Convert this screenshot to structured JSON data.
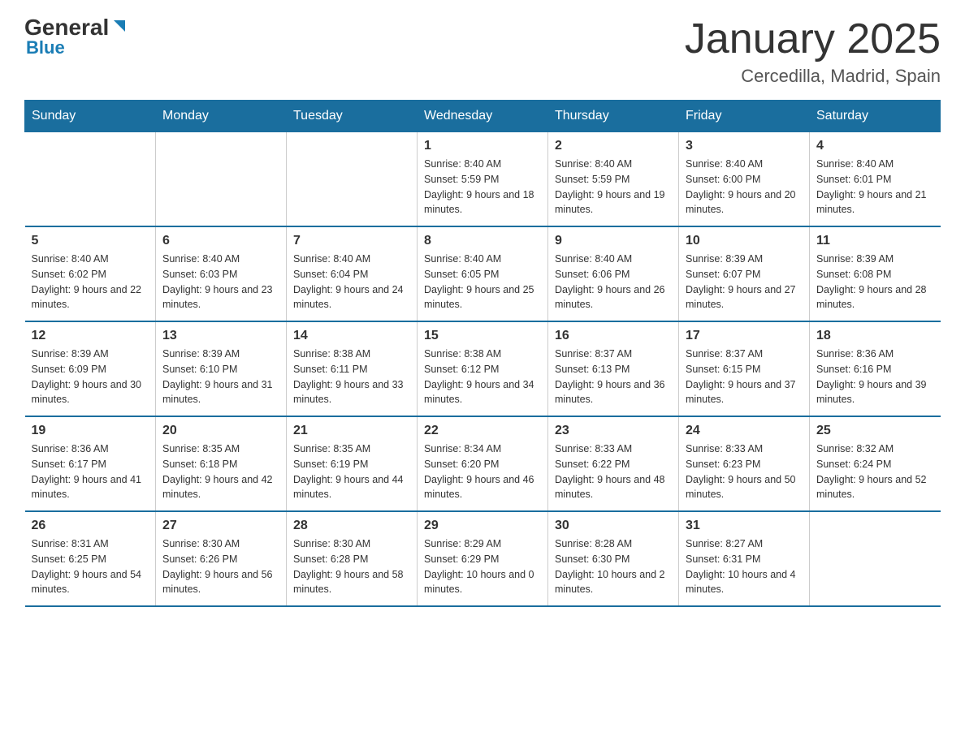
{
  "header": {
    "logo_general": "General",
    "logo_blue": "Blue",
    "month": "January 2025",
    "location": "Cercedilla, Madrid, Spain"
  },
  "days_of_week": [
    "Sunday",
    "Monday",
    "Tuesday",
    "Wednesday",
    "Thursday",
    "Friday",
    "Saturday"
  ],
  "weeks": [
    [
      {
        "day": "",
        "sunrise": "",
        "sunset": "",
        "daylight": ""
      },
      {
        "day": "",
        "sunrise": "",
        "sunset": "",
        "daylight": ""
      },
      {
        "day": "",
        "sunrise": "",
        "sunset": "",
        "daylight": ""
      },
      {
        "day": "1",
        "sunrise": "Sunrise: 8:40 AM",
        "sunset": "Sunset: 5:59 PM",
        "daylight": "Daylight: 9 hours and 18 minutes."
      },
      {
        "day": "2",
        "sunrise": "Sunrise: 8:40 AM",
        "sunset": "Sunset: 5:59 PM",
        "daylight": "Daylight: 9 hours and 19 minutes."
      },
      {
        "day": "3",
        "sunrise": "Sunrise: 8:40 AM",
        "sunset": "Sunset: 6:00 PM",
        "daylight": "Daylight: 9 hours and 20 minutes."
      },
      {
        "day": "4",
        "sunrise": "Sunrise: 8:40 AM",
        "sunset": "Sunset: 6:01 PM",
        "daylight": "Daylight: 9 hours and 21 minutes."
      }
    ],
    [
      {
        "day": "5",
        "sunrise": "Sunrise: 8:40 AM",
        "sunset": "Sunset: 6:02 PM",
        "daylight": "Daylight: 9 hours and 22 minutes."
      },
      {
        "day": "6",
        "sunrise": "Sunrise: 8:40 AM",
        "sunset": "Sunset: 6:03 PM",
        "daylight": "Daylight: 9 hours and 23 minutes."
      },
      {
        "day": "7",
        "sunrise": "Sunrise: 8:40 AM",
        "sunset": "Sunset: 6:04 PM",
        "daylight": "Daylight: 9 hours and 24 minutes."
      },
      {
        "day": "8",
        "sunrise": "Sunrise: 8:40 AM",
        "sunset": "Sunset: 6:05 PM",
        "daylight": "Daylight: 9 hours and 25 minutes."
      },
      {
        "day": "9",
        "sunrise": "Sunrise: 8:40 AM",
        "sunset": "Sunset: 6:06 PM",
        "daylight": "Daylight: 9 hours and 26 minutes."
      },
      {
        "day": "10",
        "sunrise": "Sunrise: 8:39 AM",
        "sunset": "Sunset: 6:07 PM",
        "daylight": "Daylight: 9 hours and 27 minutes."
      },
      {
        "day": "11",
        "sunrise": "Sunrise: 8:39 AM",
        "sunset": "Sunset: 6:08 PM",
        "daylight": "Daylight: 9 hours and 28 minutes."
      }
    ],
    [
      {
        "day": "12",
        "sunrise": "Sunrise: 8:39 AM",
        "sunset": "Sunset: 6:09 PM",
        "daylight": "Daylight: 9 hours and 30 minutes."
      },
      {
        "day": "13",
        "sunrise": "Sunrise: 8:39 AM",
        "sunset": "Sunset: 6:10 PM",
        "daylight": "Daylight: 9 hours and 31 minutes."
      },
      {
        "day": "14",
        "sunrise": "Sunrise: 8:38 AM",
        "sunset": "Sunset: 6:11 PM",
        "daylight": "Daylight: 9 hours and 33 minutes."
      },
      {
        "day": "15",
        "sunrise": "Sunrise: 8:38 AM",
        "sunset": "Sunset: 6:12 PM",
        "daylight": "Daylight: 9 hours and 34 minutes."
      },
      {
        "day": "16",
        "sunrise": "Sunrise: 8:37 AM",
        "sunset": "Sunset: 6:13 PM",
        "daylight": "Daylight: 9 hours and 36 minutes."
      },
      {
        "day": "17",
        "sunrise": "Sunrise: 8:37 AM",
        "sunset": "Sunset: 6:15 PM",
        "daylight": "Daylight: 9 hours and 37 minutes."
      },
      {
        "day": "18",
        "sunrise": "Sunrise: 8:36 AM",
        "sunset": "Sunset: 6:16 PM",
        "daylight": "Daylight: 9 hours and 39 minutes."
      }
    ],
    [
      {
        "day": "19",
        "sunrise": "Sunrise: 8:36 AM",
        "sunset": "Sunset: 6:17 PM",
        "daylight": "Daylight: 9 hours and 41 minutes."
      },
      {
        "day": "20",
        "sunrise": "Sunrise: 8:35 AM",
        "sunset": "Sunset: 6:18 PM",
        "daylight": "Daylight: 9 hours and 42 minutes."
      },
      {
        "day": "21",
        "sunrise": "Sunrise: 8:35 AM",
        "sunset": "Sunset: 6:19 PM",
        "daylight": "Daylight: 9 hours and 44 minutes."
      },
      {
        "day": "22",
        "sunrise": "Sunrise: 8:34 AM",
        "sunset": "Sunset: 6:20 PM",
        "daylight": "Daylight: 9 hours and 46 minutes."
      },
      {
        "day": "23",
        "sunrise": "Sunrise: 8:33 AM",
        "sunset": "Sunset: 6:22 PM",
        "daylight": "Daylight: 9 hours and 48 minutes."
      },
      {
        "day": "24",
        "sunrise": "Sunrise: 8:33 AM",
        "sunset": "Sunset: 6:23 PM",
        "daylight": "Daylight: 9 hours and 50 minutes."
      },
      {
        "day": "25",
        "sunrise": "Sunrise: 8:32 AM",
        "sunset": "Sunset: 6:24 PM",
        "daylight": "Daylight: 9 hours and 52 minutes."
      }
    ],
    [
      {
        "day": "26",
        "sunrise": "Sunrise: 8:31 AM",
        "sunset": "Sunset: 6:25 PM",
        "daylight": "Daylight: 9 hours and 54 minutes."
      },
      {
        "day": "27",
        "sunrise": "Sunrise: 8:30 AM",
        "sunset": "Sunset: 6:26 PM",
        "daylight": "Daylight: 9 hours and 56 minutes."
      },
      {
        "day": "28",
        "sunrise": "Sunrise: 8:30 AM",
        "sunset": "Sunset: 6:28 PM",
        "daylight": "Daylight: 9 hours and 58 minutes."
      },
      {
        "day": "29",
        "sunrise": "Sunrise: 8:29 AM",
        "sunset": "Sunset: 6:29 PM",
        "daylight": "Daylight: 10 hours and 0 minutes."
      },
      {
        "day": "30",
        "sunrise": "Sunrise: 8:28 AM",
        "sunset": "Sunset: 6:30 PM",
        "daylight": "Daylight: 10 hours and 2 minutes."
      },
      {
        "day": "31",
        "sunrise": "Sunrise: 8:27 AM",
        "sunset": "Sunset: 6:31 PM",
        "daylight": "Daylight: 10 hours and 4 minutes."
      },
      {
        "day": "",
        "sunrise": "",
        "sunset": "",
        "daylight": ""
      }
    ]
  ]
}
